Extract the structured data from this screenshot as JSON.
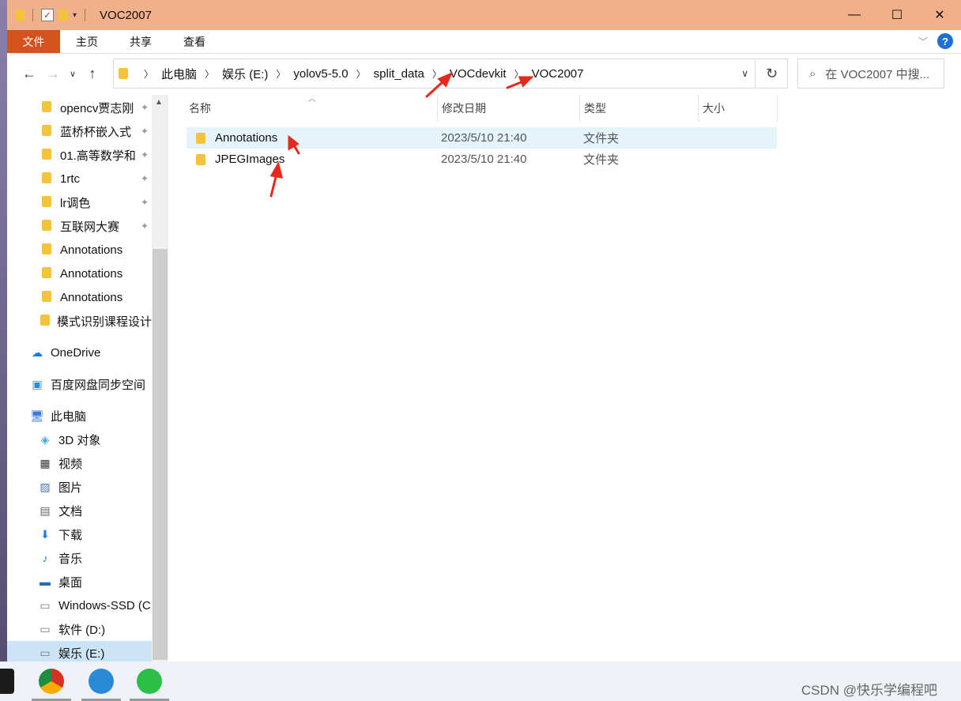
{
  "window": {
    "title": "VOC2007",
    "controls": {
      "minimize": "—",
      "maximize": "☐",
      "close": "✕"
    }
  },
  "ribbon": {
    "tabs": [
      "文件",
      "主页",
      "共享",
      "查看"
    ],
    "help_label": "?"
  },
  "address": {
    "crumbs": [
      "此电脑",
      "娱乐 (E:)",
      "yolov5-5.0",
      "split_data",
      "VOCdevkit",
      "VOC2007"
    ],
    "search_placeholder": "在 VOC2007 中搜..."
  },
  "sidebar": {
    "quick_access": [
      {
        "label": "opencv贾志刚",
        "pinned": true
      },
      {
        "label": "蓝桥杯嵌入式",
        "pinned": true
      },
      {
        "label": "01.高等数学和",
        "pinned": true
      },
      {
        "label": "1rtc",
        "pinned": true
      },
      {
        "label": "lr调色",
        "pinned": true
      },
      {
        "label": "互联网大赛",
        "pinned": true
      },
      {
        "label": "Annotations",
        "pinned": false
      },
      {
        "label": "Annotations",
        "pinned": false
      },
      {
        "label": "Annotations",
        "pinned": false
      },
      {
        "label": "模式识别课程设计",
        "pinned": false
      }
    ],
    "onedrive": "OneDrive",
    "baidu": "百度网盘同步空间",
    "this_pc": "此电脑",
    "pc_items": [
      {
        "label": "3D 对象",
        "icon": "cube-icon"
      },
      {
        "label": "视频",
        "icon": "video-icon"
      },
      {
        "label": "图片",
        "icon": "picture-icon"
      },
      {
        "label": "文档",
        "icon": "document-icon"
      },
      {
        "label": "下载",
        "icon": "download-icon"
      },
      {
        "label": "音乐",
        "icon": "music-icon"
      },
      {
        "label": "桌面",
        "icon": "desktop-icon"
      },
      {
        "label": "Windows-SSD (C",
        "icon": "drive-icon"
      },
      {
        "label": "软件 (D:)",
        "icon": "drive-icon"
      },
      {
        "label": "娱乐 (E:)",
        "icon": "drive-icon"
      }
    ]
  },
  "columns": {
    "name": "名称",
    "date": "修改日期",
    "type": "类型",
    "size": "大小"
  },
  "files": [
    {
      "name": "Annotations",
      "date": "2023/5/10 21:40",
      "type": "文件夹"
    },
    {
      "name": "JPEGImages",
      "date": "2023/5/10 21:40",
      "type": "文件夹"
    }
  ],
  "watermark": "CSDN @快乐学编程吧",
  "colors": {
    "titlebar": "#f0b08a",
    "file_tab": "#d4521e",
    "selection": "#cce4f7",
    "annotation_arrow": "#e8281c"
  }
}
